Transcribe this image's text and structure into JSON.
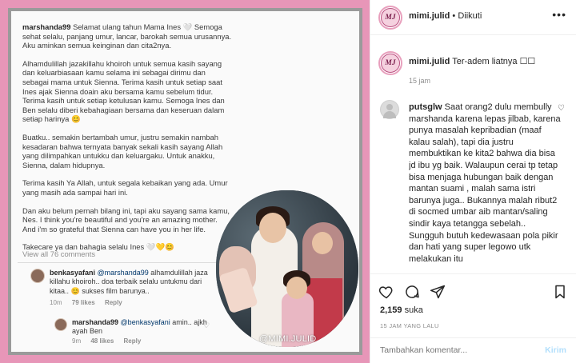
{
  "media": {
    "caption_username": "marshanda99",
    "caption_paragraphs": [
      "Selamat ulang tahun Mama Ines 🤍 Semoga sehat selalu, panjang umur, lancar, barokah semua urusannya. Aku aminkan semua keinginan dan cita2nya.",
      "Alhamdulillah jazakillahu khoiroh untuk semua kasih sayang dan keluarbiasaan kamu selama ini sebagai dirimu dan sebagai mama untuk Sienna. Terima kasih untuk setiap saat Ines ajak Sienna doain aku bersama kamu sebelum tidur. Terima kasih untuk setiap ketulusan kamu. Semoga Ines dan Ben selalu diberi kebahagiaan bersama dan keseruan dalam setiap harinya 😊",
      "Buatku.. semakin bertambah umur, justru semakin nambah kesadaran bahwa ternyata banyak sekali kasih sayang Allah yang dilimpahkan untukku dan keluargaku. Untuk anakku, Sienna, dalam hidupnya.",
      "Terima kasih Ya Allah, untuk segala kebaikan yang ada. Umur yang masih ada sampai hari ini.",
      "Dan aku belum pernah bilang ini, tapi aku sayang sama kamu, Nes. I think you're beautiful and you're an amazing mother. And i'm so grateful that Sienna can have you in her life.",
      "Takecare ya dan bahagia selalu Ines 🤍💛😊"
    ],
    "view_all": "View all 76 comments",
    "comments": [
      {
        "username": "benkasyafani",
        "mention": "@marshanda99",
        "text": "alhamdulillah jaza killahu khoiroh.. doa terbaik selalu untukmu dari kitaa.. 😊 sukses film barunya..",
        "time": "10m",
        "likes": "79 likes",
        "reply": "Reply"
      },
      {
        "username": "marshanda99",
        "mention": "@benkasyafani",
        "text": "amin.. ajkh ayah Ben",
        "time": "9m",
        "likes": "48 likes",
        "reply": "Reply"
      }
    ],
    "watermark": "@MIMI.JULID"
  },
  "post_header": {
    "avatar_text": "MJ",
    "username": "mimi.julid",
    "separator": "•",
    "follow_state": "Diikuti",
    "more": "•••"
  },
  "caption": {
    "username": "mimi.julid",
    "text": "Ter-adem liatnya ☐☐",
    "time": "15 jam"
  },
  "comment": {
    "username": "putsglw",
    "text": "Saat orang2 dulu membully marshanda karena lepas jilbab, karena punya masalah kepribadian (maaf kalau salah), tapi dia justru membuktikan ke kita2 bahwa dia bisa jd ibu yg baik. Walaupun cerai tp tetap bisa menjaga hubungan baik dengan mantan suami , malah sama istri barunya juga.. Bukannya malah ribut2 di socmed umbar aib mantan/saling sindir kaya tetangga sebelah.. Sungguh butuh kedewasaan pola pikir dan hati yang super legowo utk melakukan itu"
  },
  "actions": {
    "likes_count": "2,159",
    "likes_label": "suka",
    "posted": "15 JAM YANG LALU"
  },
  "add_comment": {
    "placeholder": "Tambahkan komentar...",
    "send": "Kirim"
  },
  "colors": {
    "frame_pink": "#e796b8",
    "link_blue_disabled": "#b2dffc",
    "text_dark": "#262626",
    "text_muted": "#8e8e8e"
  }
}
